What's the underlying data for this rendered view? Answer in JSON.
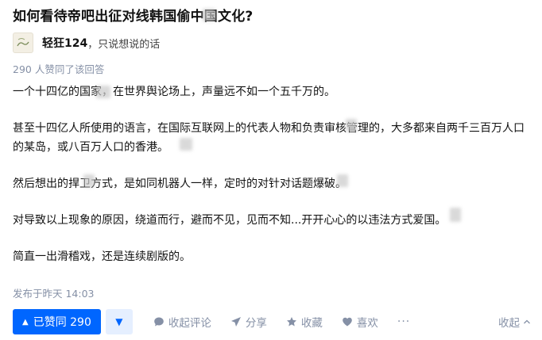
{
  "question": {
    "title": "如何看待帝吧出征对线韩国偷中国文化?"
  },
  "author": {
    "name": "轻狂124",
    "bio": "，只说想说的话"
  },
  "answer": {
    "vote_note": "290 人赞同了该回答",
    "paragraphs": [
      "一个十四亿的国家，在世界舆论场上，声量远不如一个五千万的。",
      "甚至十四亿人所使用的语言，在国际互联网上的代表人物和负责审核管理的，大多都来自两千三百万人口的某岛，或八百万人口的香港。",
      "然后想出的捍卫方式，是如同机器人一样，定时的对针对话题爆破。",
      "对导致以上现象的原因，绕道而行，避而不见，见而不知...开开心心的以违法方式爱国。",
      "简直一出滑稽戏，还是连续剧版的。"
    ],
    "time": "发布于昨天 14:03"
  },
  "actions": {
    "voted_label": "已赞同 290",
    "comment": "收起评论",
    "share": "分享",
    "favorite": "收藏",
    "like": "喜欢",
    "more": "···",
    "collapse": "收起"
  },
  "colors": {
    "accent": "#0066ff",
    "muted": "#8590a6",
    "down_bg": "#e5efff"
  }
}
